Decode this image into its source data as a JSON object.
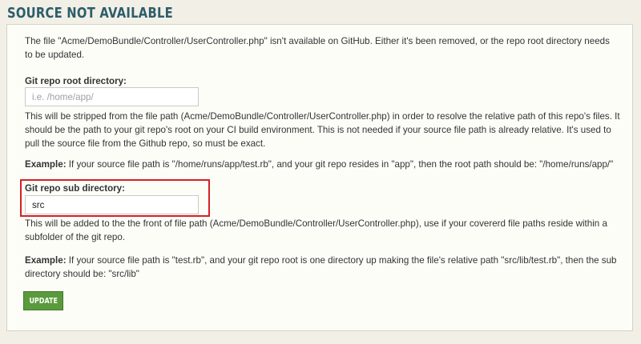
{
  "page": {
    "title": "SOURCE NOT AVAILABLE"
  },
  "notice": "The file \"Acme/DemoBundle/Controller/UserController.php\" isn't available on GitHub. Either it's been removed, or the repo root directory needs to be updated.",
  "root_dir": {
    "label": "Git repo root directory:",
    "placeholder": "i.e. /home/app/",
    "value": "",
    "help": "This will be stripped from the file path (Acme/DemoBundle/Controller/UserController.php) in order to resolve the relative path of this repo's files. It should be the path to your git repo's root on your CI build environment. This is not needed if your source file path is already relative. It's used to pull the source file from the Github repo, so must be exact.",
    "example_label": "Example:",
    "example_text": " If your source file path is \"/home/runs/app/test.rb\", and your git repo resides in \"app\", then the root path should be: \"/home/runs/app/\""
  },
  "sub_dir": {
    "label": "Git repo sub directory:",
    "value": "src",
    "help": "This will be added to the the front of file path (Acme/DemoBundle/Controller/UserController.php), use if your covererd file paths reside within a subfolder of the git repo.",
    "example_label": "Example:",
    "example_text": " If your source file path is \"test.rb\", and your git repo root is one directory up making the file's relative path \"src/lib/test.rb\", then the sub directory should be: \"src/lib\""
  },
  "actions": {
    "update_label": "UPDATE"
  },
  "colors": {
    "title": "#2d5d6b",
    "button": "#5a9a3c",
    "highlight": "#d22226"
  }
}
